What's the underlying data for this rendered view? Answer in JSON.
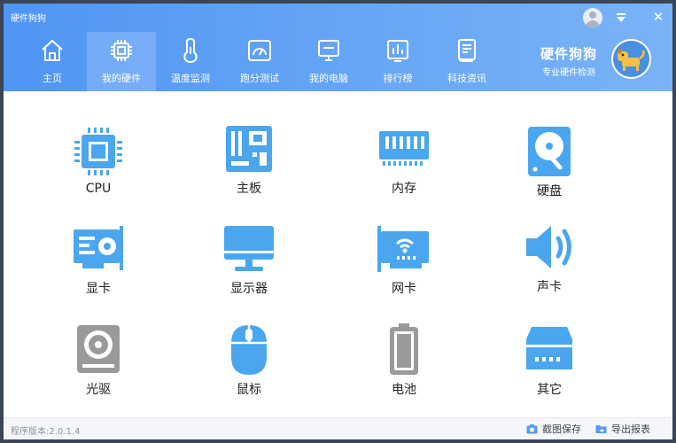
{
  "app": {
    "title": "硬件狗狗"
  },
  "brand": {
    "name": "硬件狗狗",
    "subtitle": "专业硬件检测"
  },
  "nav": {
    "items": [
      {
        "label": "主页",
        "icon": "home-icon",
        "active": false
      },
      {
        "label": "我的硬件",
        "icon": "chip-icon",
        "active": true
      },
      {
        "label": "温度监测",
        "icon": "thermometer-icon",
        "active": false
      },
      {
        "label": "跑分测试",
        "icon": "speedometer-icon",
        "active": false
      },
      {
        "label": "我的电脑",
        "icon": "monitor-icon",
        "active": false
      },
      {
        "label": "排行榜",
        "icon": "bar-chart-icon",
        "active": false
      },
      {
        "label": "科技资讯",
        "icon": "news-icon",
        "active": false
      }
    ]
  },
  "hardware": {
    "items": [
      {
        "label": "CPU",
        "icon": "cpu-icon"
      },
      {
        "label": "主板",
        "icon": "motherboard-icon"
      },
      {
        "label": "内存",
        "icon": "memory-icon"
      },
      {
        "label": "硬盘",
        "icon": "hard-disk-icon"
      },
      {
        "label": "显卡",
        "icon": "graphics-card-icon"
      },
      {
        "label": "显示器",
        "icon": "display-icon"
      },
      {
        "label": "网卡",
        "icon": "network-card-icon"
      },
      {
        "label": "声卡",
        "icon": "sound-card-icon"
      },
      {
        "label": "光驱",
        "icon": "optical-drive-icon"
      },
      {
        "label": "鼠标",
        "icon": "mouse-icon"
      },
      {
        "label": "电池",
        "icon": "battery-icon"
      },
      {
        "label": "其它",
        "icon": "other-device-icon"
      }
    ]
  },
  "footer": {
    "version": "程序版本:2.0.1.4",
    "screenshot_label": "截图保存",
    "export_label": "导出报表"
  },
  "colors": {
    "header": "#5b9cf5",
    "icon_blue": "#4aa6ee",
    "icon_gray": "#9a9a9a"
  }
}
